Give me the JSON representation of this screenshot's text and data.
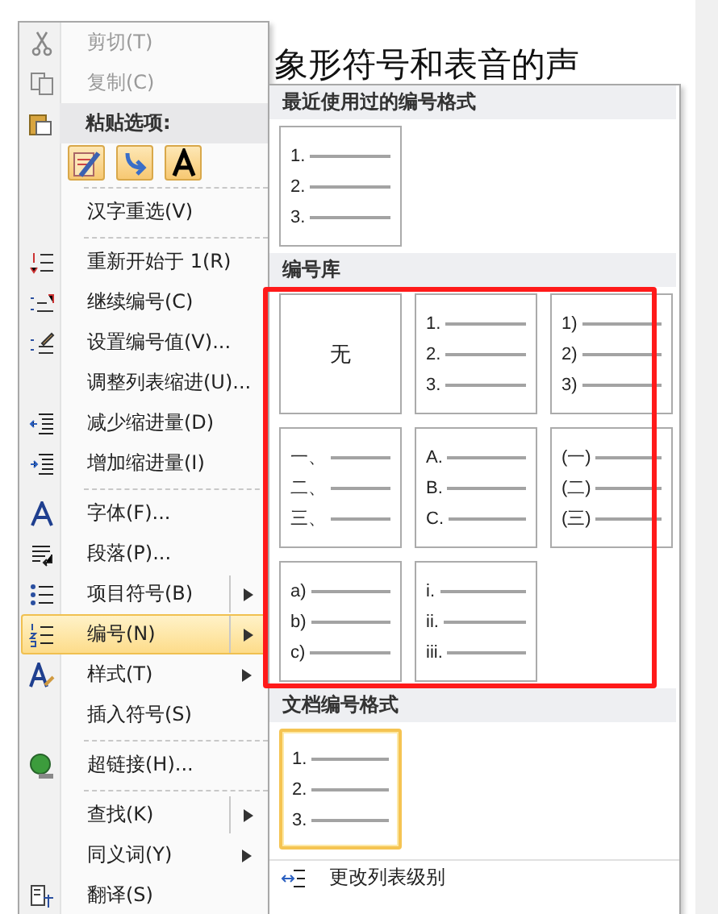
{
  "document": {
    "text": "象形符号和表音的声"
  },
  "context_menu": {
    "items": [
      {
        "kind": "item",
        "label": "剪切(T)",
        "disabled": true,
        "selected": false,
        "submenu": false
      },
      {
        "kind": "item",
        "label": "复制(C)",
        "disabled": true,
        "selected": false,
        "submenu": false
      },
      {
        "kind": "header",
        "label": "粘贴选项:"
      },
      {
        "kind": "paste_buttons"
      },
      {
        "kind": "separator"
      },
      {
        "kind": "item",
        "label": "汉字重选(V)",
        "disabled": false,
        "selected": false,
        "submenu": false
      },
      {
        "kind": "separator"
      },
      {
        "kind": "item",
        "label": "重新开始于 1(R)",
        "disabled": false,
        "selected": false,
        "submenu": false
      },
      {
        "kind": "item",
        "label": "继续编号(C)",
        "disabled": false,
        "selected": false,
        "submenu": false
      },
      {
        "kind": "item",
        "label": "设置编号值(V)...",
        "disabled": false,
        "selected": false,
        "submenu": false
      },
      {
        "kind": "item",
        "label": "调整列表缩进(U)...",
        "disabled": false,
        "selected": false,
        "submenu": false
      },
      {
        "kind": "item",
        "label": "减少缩进量(D)",
        "disabled": false,
        "selected": false,
        "submenu": false
      },
      {
        "kind": "item",
        "label": "增加缩进量(I)",
        "disabled": false,
        "selected": false,
        "submenu": false
      },
      {
        "kind": "separator"
      },
      {
        "kind": "item",
        "label": "字体(F)...",
        "disabled": false,
        "selected": false,
        "submenu": false
      },
      {
        "kind": "item",
        "label": "段落(P)...",
        "disabled": false,
        "selected": false,
        "submenu": false
      },
      {
        "kind": "item",
        "label": "项目符号(B)",
        "disabled": false,
        "selected": false,
        "submenu": true,
        "split": true
      },
      {
        "kind": "item",
        "label": "编号(N)",
        "disabled": false,
        "selected": true,
        "submenu": true,
        "split": true
      },
      {
        "kind": "item",
        "label": "样式(T)",
        "disabled": false,
        "selected": false,
        "submenu": true,
        "split": false
      },
      {
        "kind": "item",
        "label": "插入符号(S)",
        "disabled": false,
        "selected": false,
        "submenu": false
      },
      {
        "kind": "separator"
      },
      {
        "kind": "item",
        "label": "超链接(H)...",
        "disabled": false,
        "selected": false,
        "submenu": false
      },
      {
        "kind": "separator"
      },
      {
        "kind": "item",
        "label": "查找(K)",
        "disabled": false,
        "selected": false,
        "submenu": true,
        "split": true
      },
      {
        "kind": "item",
        "label": "同义词(Y)",
        "disabled": false,
        "selected": false,
        "submenu": true,
        "split": false
      },
      {
        "kind": "item",
        "label": "翻译(S)",
        "disabled": false,
        "selected": false,
        "submenu": false
      }
    ]
  },
  "numbering_panel": {
    "recent": {
      "title": "最近使用过的编号格式",
      "tiles": [
        {
          "kind": "list",
          "selected": false,
          "markers": [
            "1.",
            "2.",
            "3."
          ]
        }
      ]
    },
    "library": {
      "title": "编号库",
      "tiles": [
        {
          "kind": "none",
          "selected": false,
          "label": "无"
        },
        {
          "kind": "list",
          "selected": false,
          "markers": [
            "1.",
            "2.",
            "3."
          ]
        },
        {
          "kind": "list",
          "selected": false,
          "markers": [
            "1)",
            "2)",
            "3)"
          ]
        },
        {
          "kind": "list",
          "selected": false,
          "markers": [
            "一、",
            "二、",
            "三、"
          ]
        },
        {
          "kind": "list",
          "selected": false,
          "markers": [
            "A.",
            "B.",
            "C."
          ]
        },
        {
          "kind": "list",
          "selected": false,
          "markers": [
            "(一)",
            "(二)",
            "(三)"
          ]
        },
        {
          "kind": "list",
          "selected": false,
          "markers": [
            "a)",
            "b)",
            "c)"
          ]
        },
        {
          "kind": "list",
          "selected": false,
          "markers": [
            "i.",
            "ii.",
            "iii."
          ]
        }
      ]
    },
    "document_formats": {
      "title": "文档编号格式",
      "tiles": [
        {
          "kind": "list",
          "selected": true,
          "markers": [
            "1.",
            "2.",
            "3."
          ]
        }
      ]
    },
    "footer_item": {
      "label": "更改列表级别"
    }
  }
}
